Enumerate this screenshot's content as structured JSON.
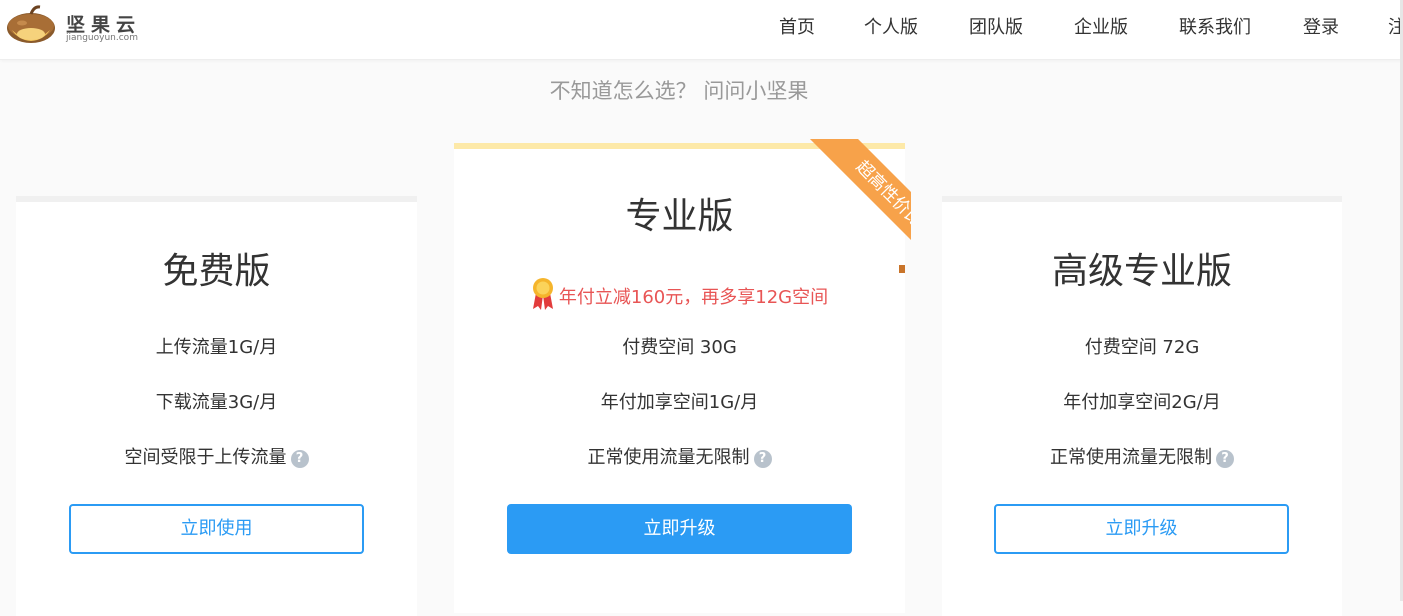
{
  "header": {
    "brand_name": "坚果云",
    "brand_domain": "jianguoyun.com",
    "nav": [
      "首页",
      "个人版",
      "团队版",
      "企业版",
      "联系我们",
      "登录",
      "注"
    ]
  },
  "helper_text": "不知道怎么选？ 问问小坚果",
  "plans": [
    {
      "title": "免费版",
      "features": [
        "上传流量1G/月",
        "下载流量3G/月",
        "空间受限于上传流量"
      ],
      "button": "立即使用"
    },
    {
      "title": "专业版",
      "ribbon": "超高性价比",
      "promo": "年付立减160元，再多享12G空间",
      "features": [
        "付费空间 30G",
        "年付加享空间1G/月",
        "正常使用流量无限制"
      ],
      "button": "立即升级"
    },
    {
      "title": "高级专业版",
      "features": [
        "付费空间 72G",
        "年付加享空间2G/月",
        "正常使用流量无限制"
      ],
      "button": "立即升级"
    }
  ],
  "help_glyph": "?",
  "colors": {
    "accent": "#2b9bf4",
    "promo": "#e85555",
    "ribbon": "#f7a24a",
    "featured_top": "#fde9a8"
  }
}
